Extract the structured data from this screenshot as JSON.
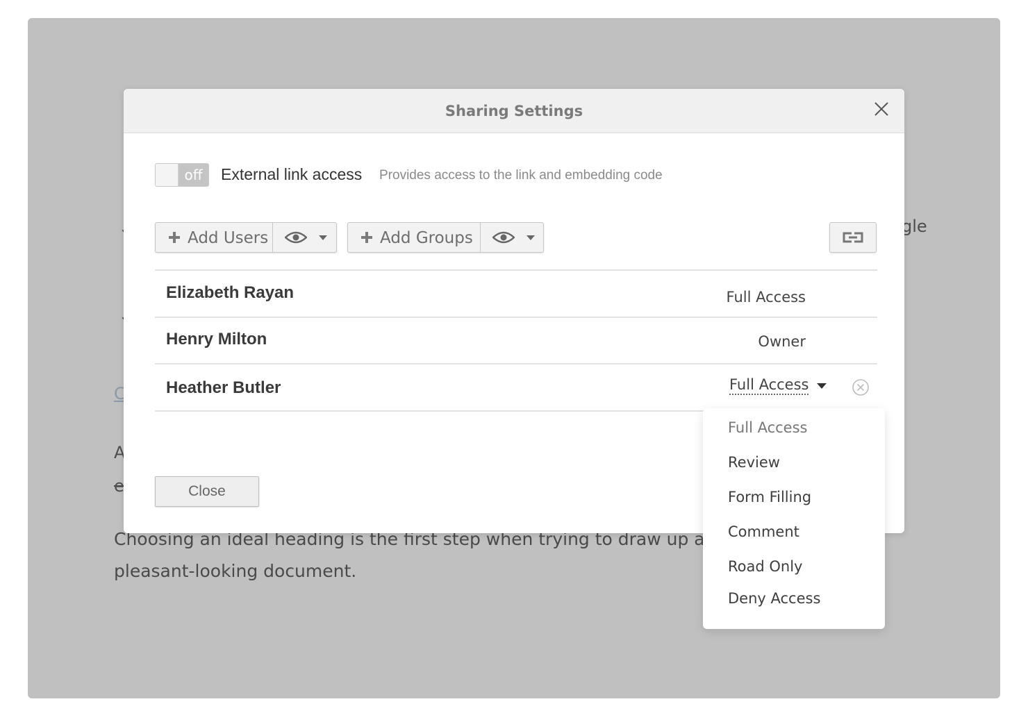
{
  "background": {
    "paragraph_line1": "Choosing an ideal heading is the first step when trying to draw up a we",
    "paragraph_line2": "pleasant-looking document.",
    "fragment_right": "gle",
    "fragment_left1": "A",
    "fragment_left2": "e",
    "fragment_link": "C"
  },
  "modal": {
    "title": "Sharing Settings",
    "external_link": {
      "toggle_state": "off",
      "label": "External link access",
      "description": "Provides access to the link and embedding code"
    },
    "toolbar": {
      "add_users_label": "Add Users",
      "add_groups_label": "Add Groups"
    },
    "users": [
      {
        "name": "Elizabeth Rayan",
        "access": "Full Access"
      },
      {
        "name": "Henry Milton",
        "access": "Owner"
      },
      {
        "name": "Heather Butler",
        "access": "Full Access"
      }
    ],
    "close_label": "Close"
  },
  "access_dropdown": {
    "selected": "Full Access",
    "options": [
      "Full Access",
      "Review",
      "Form Filling",
      "Comment",
      "Road Only",
      "Deny Access"
    ]
  }
}
